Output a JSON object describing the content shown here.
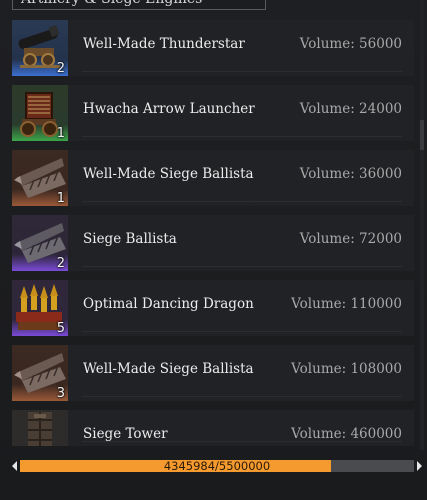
{
  "header": {
    "title": "Artillery & Siege Engines"
  },
  "colors": {
    "blue_grade": "#3b6fd0",
    "green_grade": "#3da64a",
    "bronze_grade": "#9a5a38",
    "purple_grade": "#7a4bd6",
    "bar_fill": "#f59a2e"
  },
  "items": [
    {
      "name": "Well-Made Thunderstar",
      "volume": "Volume: 56000",
      "qty": "2",
      "icon": "cannon-icon",
      "grade": "blue"
    },
    {
      "name": "Hwacha Arrow Launcher",
      "volume": "Volume: 24000",
      "qty": "1",
      "icon": "hwacha-icon",
      "grade": "green"
    },
    {
      "name": "Well-Made Siege Ballista",
      "volume": "Volume: 36000",
      "qty": "1",
      "icon": "ballista-icon",
      "grade": "bronze"
    },
    {
      "name": "Siege Ballista",
      "volume": "Volume: 72000",
      "qty": "2",
      "icon": "ballista-icon",
      "grade": "purple"
    },
    {
      "name": "Optimal Dancing Dragon",
      "volume": "Volume: 110000",
      "qty": "5",
      "icon": "dragon-rockets-icon",
      "grade": "purple"
    },
    {
      "name": "Well-Made Siege Ballista",
      "volume": "Volume: 108000",
      "qty": "3",
      "icon": "ballista-icon",
      "grade": "bronze"
    },
    {
      "name": "Siege Tower",
      "volume": "Volume: 460000",
      "qty": "",
      "icon": "siege-tower-icon",
      "grade": "none"
    }
  ],
  "capacity": {
    "label": "4345984/5500000",
    "fraction": 0.79
  }
}
